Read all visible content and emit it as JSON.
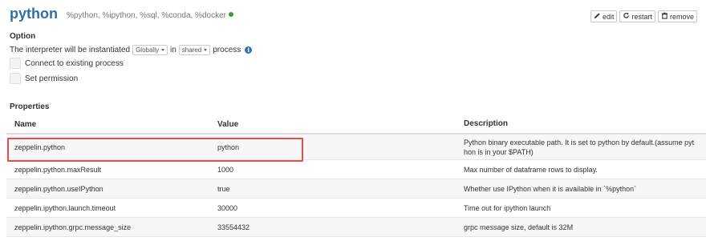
{
  "header": {
    "title": "python",
    "subtitle": "%python, %ipython, %sql, %conda, %docker",
    "status_color": "#3a9b3a",
    "buttons": [
      {
        "label": "edit",
        "icon": "pencil-icon"
      },
      {
        "label": "restart",
        "icon": "refresh-icon"
      },
      {
        "label": "remove",
        "icon": "trash-icon"
      }
    ]
  },
  "option": {
    "title": "Option",
    "instantiate_prefix": "The interpreter will be instantiated",
    "scope_value": "Globally",
    "in_text": "in",
    "process_value": "shared",
    "process_text": "process",
    "info_icon": "info-icon",
    "connect_label": "Connect to existing process",
    "permission_label": "Set permission"
  },
  "properties": {
    "title": "Properties",
    "headers": [
      "Name",
      "Value",
      "Description"
    ],
    "rows": [
      {
        "name": "zeppelin.python",
        "value": "python",
        "description": "Python binary executable path. It is set to python by default.(assume pyt hon is in your $PATH)"
      },
      {
        "name": "zeppelin.python.maxResult",
        "value": "1000",
        "description": "Max number of dataframe rows to display."
      },
      {
        "name": "zeppelin.python.useIPython",
        "value": "true",
        "description": "Whether use IPython when it is available in `%python`"
      },
      {
        "name": "zeppelin.ipython.launch.timeout",
        "value": "30000",
        "description": "Time out for ipython launch"
      },
      {
        "name": "zeppelin.ipython.grpc.message_size",
        "value": "33554432",
        "description": "grpc message size, default is 32M"
      }
    ]
  },
  "colors": {
    "title": "#3071a9",
    "highlight_border": "#d9534f"
  }
}
